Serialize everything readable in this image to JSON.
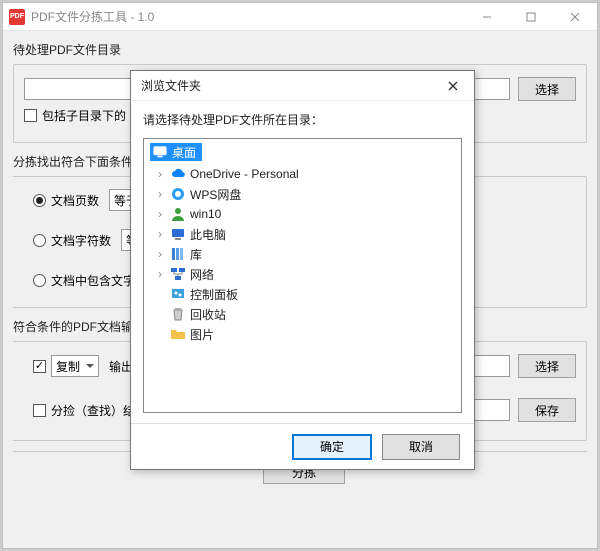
{
  "window": {
    "title": "PDF文件分拣工具 - 1.0"
  },
  "section": {
    "input_dir": "待处理PDF文件目录",
    "filter": "分拣找出符合下面条件",
    "output": "符合条件的PDF文档输出"
  },
  "options": {
    "include_sub_label": "包括子目录下的",
    "page_count_label": "文档页数",
    "page_count_op": "等于",
    "char_count_label": "文档字符数",
    "char_count_op": "等",
    "contains_text_label": "文档中包含文字",
    "copy_label": "复制",
    "output_label": "输出",
    "sort_result_label": "分捡（查找）结果"
  },
  "buttons": {
    "browse": "选择",
    "browse2": "选择",
    "save": "保存",
    "sort": "分拣"
  },
  "dialog": {
    "title": "浏览文件夹",
    "message": "请选择待处理PDF文件所在目录：",
    "ok": "确定",
    "cancel": "取消",
    "tree": {
      "root": "桌面",
      "items": [
        {
          "label": "OneDrive - Personal",
          "icon": "cloud",
          "expand": true
        },
        {
          "label": "WPS网盘",
          "icon": "wps",
          "expand": true
        },
        {
          "label": "win10",
          "icon": "user",
          "expand": true
        },
        {
          "label": "此电脑",
          "icon": "pc",
          "expand": true
        },
        {
          "label": "库",
          "icon": "lib",
          "expand": true
        },
        {
          "label": "网络",
          "icon": "net",
          "expand": true
        },
        {
          "label": "控制面板",
          "icon": "cpl",
          "expand": false
        },
        {
          "label": "回收站",
          "icon": "bin",
          "expand": false
        },
        {
          "label": "图片",
          "icon": "folder",
          "expand": false
        }
      ]
    }
  }
}
